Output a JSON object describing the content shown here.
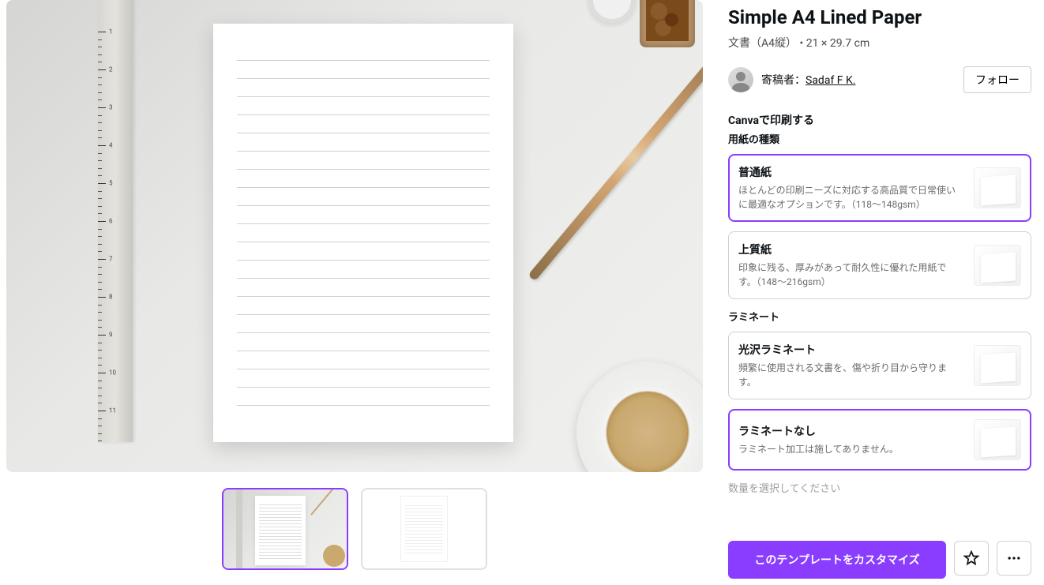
{
  "title": "Simple A4 Lined Paper",
  "meta": {
    "doctype": "文書（A4縦）",
    "separator": "•",
    "dimensions": "21 × 29.7 cm"
  },
  "author": {
    "prefix": "寄稿者：",
    "name": "Sadaf F K.",
    "follow_label": "フォロー"
  },
  "print": {
    "heading": "Canvaで印刷する",
    "paper_type_label": "用紙の種類",
    "paper_options": [
      {
        "title": "普通紙",
        "desc": "ほとんどの印刷ニーズに対応する高品質で日常使いに最適なオプションです。（118〜148gsm）",
        "selected": true
      },
      {
        "title": "上質紙",
        "desc": "印象に残る、厚みがあって耐久性に優れた用紙です。（148〜216gsm）",
        "selected": false
      }
    ],
    "laminate_label": "ラミネート",
    "laminate_options": [
      {
        "title": "光沢ラミネート",
        "desc": "頻繁に使用される文書を、傷や折り目から守ります。",
        "selected": false
      },
      {
        "title": "ラミネートなし",
        "desc": "ラミネート加工は施してありません。",
        "selected": true
      }
    ],
    "qty_label": "数量を選択してください"
  },
  "customize_button": "このテンプレートをカスタマイズ",
  "ruler_numbers": [
    "1",
    "2",
    "3",
    "4",
    "5",
    "6",
    "7",
    "8",
    "9",
    "10",
    "11"
  ]
}
